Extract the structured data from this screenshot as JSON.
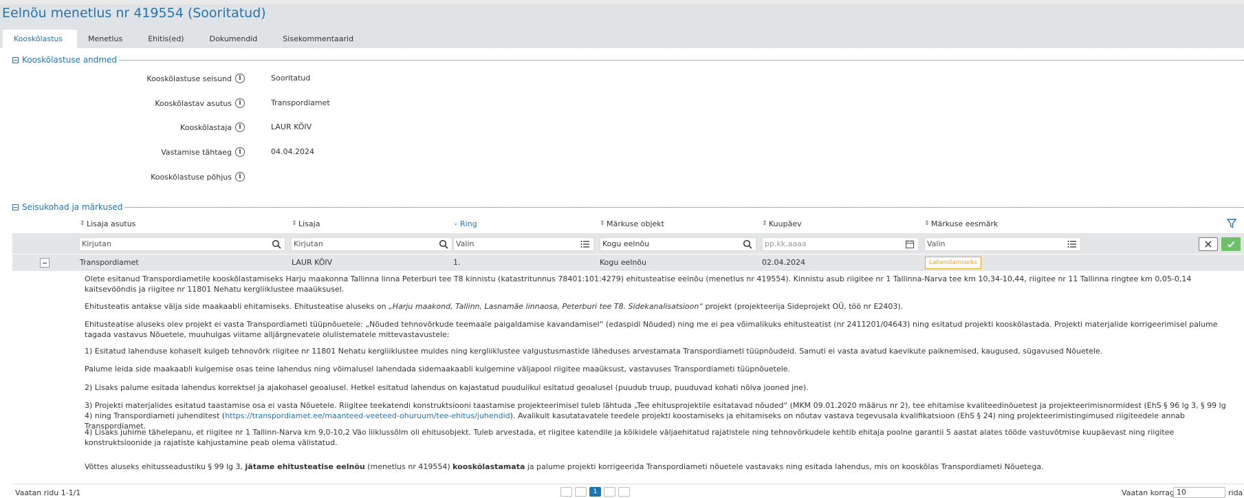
{
  "page_title": "Eelnõu menetlus nr 419554 (Sooritatud)",
  "tabs": [
    {
      "label": "Kooskõlastus",
      "active": true
    },
    {
      "label": "Menetlus",
      "active": false
    },
    {
      "label": "Ehitis(ed)",
      "active": false
    },
    {
      "label": "Dokumendid",
      "active": false
    },
    {
      "label": "Sisekommentaarid",
      "active": false
    }
  ],
  "section1": {
    "title": "Kooskõlastuse andmed",
    "fields": [
      {
        "label": "Kooskõlastuse seisund",
        "value": "Sooritatud"
      },
      {
        "label": "Kooskõlastav asutus",
        "value": "Transpordiamet"
      },
      {
        "label": "Kooskõlastaja",
        "value": "LAUR KÕIV"
      },
      {
        "label": "Vastamise tähtaeg",
        "value": "04.04.2024"
      },
      {
        "label": "Kooskõlastuse põhjus",
        "value": ""
      }
    ]
  },
  "section2": {
    "title": "Seisukohad ja märkused",
    "columns": [
      "Lisaja asutus",
      "Lisaja",
      "Ring",
      "Märkuse objekt",
      "Kuupäev",
      "Märkuse eesmärk"
    ],
    "filters": {
      "lisaja_asutus": "Kirjutan",
      "lisaja": "Kirjutan",
      "ring": "Valin",
      "objekt": "Kogu eelnõu",
      "kuupaev": "pp.kk.aaaa",
      "eesmark": "Valin"
    },
    "row": {
      "asutus": "Transpordiamet",
      "lisaja": "LAUR KÕIV",
      "ring": "1.",
      "objekt": "Kogu eelnõu",
      "kuupaev": "02.04.2024",
      "eesmark": "Lahendamiseks"
    },
    "detail": {
      "p1": "Olete esitanud Transpordiametile kooskõlastamiseks Harju maakonna Tallinna linna Peterburi tee T8 kinnistu (katastritunnus 78401:101:4279) ehitusteatise eelnõu (menetlus nr 419554). Kinnistu asub riigitee nr 1 Tallinna-Narva tee km 10,34-10,44, riigitee nr 11 Tallinna ringtee km 0,05-0,14 kaitsevööndis ja riigitee nr 11801 Nehatu kergliiklustee maaüksusel.",
      "p2_a": "Ehitusteatis antakse välja side maakaabli ehitamiseks. Ehitusteatise aluseks on ",
      "p2_b": "„Harju maakond, Tallinn, Lasnamäe linnaosa, Peterburi tee T8. Sidekanalisatsioon“",
      "p2_c": " projekt (projekteerija Sideprojekt OÜ, töö nr E2403).",
      "p3": "Ehitusteatise aluseks olev projekt ei vasta Transpordiameti tüüpnõuetele: „Nõuded tehnovõrkude teemaale paigaldamise kavandamisel“ (edaspidi Nõuded) ning me ei pea võimalikuks ehitusteatist (nr 2411201/04643) ning esitatud projekti kooskõlastada. Projekti materjalide korrigeerimisel palume tagada vastavus Nõuetele, muuhulgas viitame alljärgnevatele olulistematele mittevastavustele:",
      "p4": "1) Esitatud lahenduse kohaselt kulgeb tehnovõrk riigitee nr 11801 Nehatu kergliiklustee muldes ning kergliiklustee valgustusmastide läheduses arvestamata Transpordiameti tüüpnõudeid. Samuti ei vasta avatud kaevikute paiknemised, kaugused, sügavused Nõuetele.",
      "p5": "Palume leida side maakaabli kulgemise osas teine lahendus ning võimalusel lahendada sidemaakaabli kulgemine väljapool riigitee maaüksust, vastavuses Transpordiameti tüüpnõuetele.",
      "p6": "2) Lisaks palume esitada lahendus korrektsel ja ajakohasel geoalusel. Hetkel esitatud lahendus on kajastatud puudulikul esitatud geoalusel (puudub truup, puuduvad kohati nõlva jooned jne).",
      "p7_a": "3) Projekti materjalides esitatud taastamise osa ei vasta Nõuetele. Riigitee teekatendi konstruktsiooni taastamise projekteerimisel tuleb lähtuda „Tee ehitusprojektile esitatavad nõuded“ (MKM 09.01.2020 määrus nr 2), tee ehitamise kvaliteedinõuetest ja projekteerimisnormidest (EhS § 96 lg 3, § 99 lg 4) ning Transpordiameti juhenditest (",
      "p7_link": "https://transpordiamet.ee/maanteed-veeteed-ohuruum/tee-ehitus/juhendid",
      "p7_b": "). Avalikult kasutatavatele teedele projekti koostamiseks ja ehitamiseks on nõutav vastava tegevusala kvalifikatsioon (EhS § 24) ning projekteerimistingimused riigiteedele annab Transpordiamet.",
      "p8": "4) Lisaks juhime tähelepanu, et riigitee nr 1 Tallinn-Narva km 9,0-10,2 Väo liiklussõlm oli ehitusobjekt. Tuleb arvestada, et riigitee katendile ja kõikidele väljaehitatud rajatistele ning tehnovõrkudele kehtib ehitaja poolne garantii 5 aastat alates tööde vastuvõtmise kuupäevast ning riigitee konstruktsioonide ja rajatiste kahjustamine peab olema välistatud.",
      "p9_a": "Võttes aluseks ehitusseadustiku § 99 lg 3, ",
      "p9_b": "jätame ehitusteatise eelnõu",
      "p9_c": " (menetlus nr 419554) ",
      "p9_d": "kooskõlastamata",
      "p9_e": " ja palume projekti korrigeerida Transpordiameti nõuetele vastavaks ning esitada lahendus, mis on kooskõlas Transpordiameti Nõuetega."
    }
  },
  "footer": {
    "rows_info": "Vaatan ridu 1-1/1",
    "current_page": "1",
    "per_page_label": "Vaatan korraga",
    "per_page_value": "10",
    "per_page_suffix": "rida"
  },
  "colors": {
    "accent": "#2274b0",
    "badge": "#f5a623",
    "confirm": "#6ec06b"
  }
}
